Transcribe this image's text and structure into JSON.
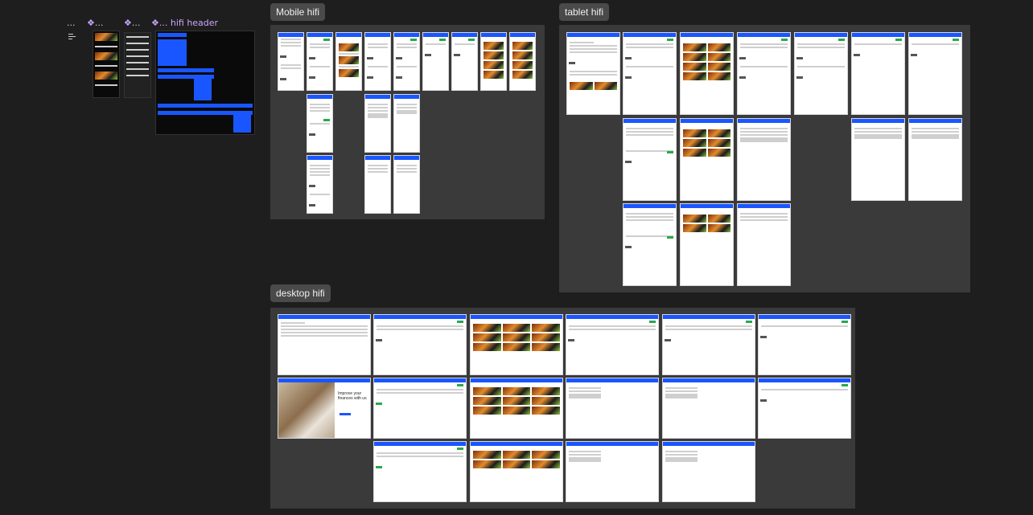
{
  "components": {
    "labels": [
      "...",
      "...",
      "...",
      "... hifi header"
    ]
  },
  "sections": {
    "mobile": "Mobile hifi",
    "tablet": "tablet hifi",
    "desktop": "desktop hifi"
  },
  "colors": {
    "canvas": "#1e1e1e",
    "section_bg": "#3a3a3a",
    "accent_blue": "#1a56ff",
    "accent_green": "#2ba84a",
    "label_purple": "#c9a6ff"
  },
  "frame_titles": {
    "desktop_hero": "Improve your finances with us"
  }
}
